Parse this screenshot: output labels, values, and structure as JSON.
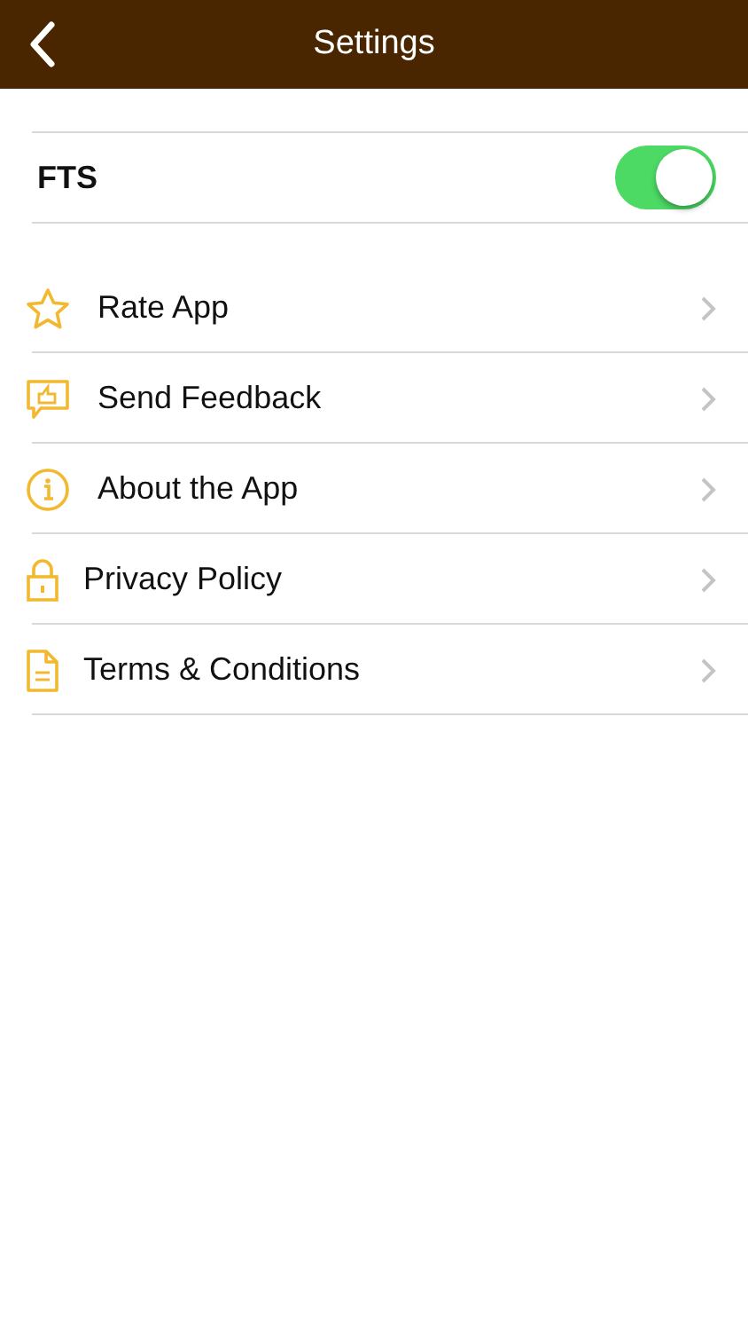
{
  "header": {
    "title": "Settings"
  },
  "toggle_row": {
    "label": "FTS",
    "on": true
  },
  "items": [
    {
      "kind": "star",
      "label": "Rate App"
    },
    {
      "kind": "feedback",
      "label": "Send Feedback"
    },
    {
      "kind": "info",
      "label": "About the App"
    },
    {
      "kind": "lock",
      "label": "Privacy Policy"
    },
    {
      "kind": "document",
      "label": "Terms & Conditions"
    }
  ]
}
